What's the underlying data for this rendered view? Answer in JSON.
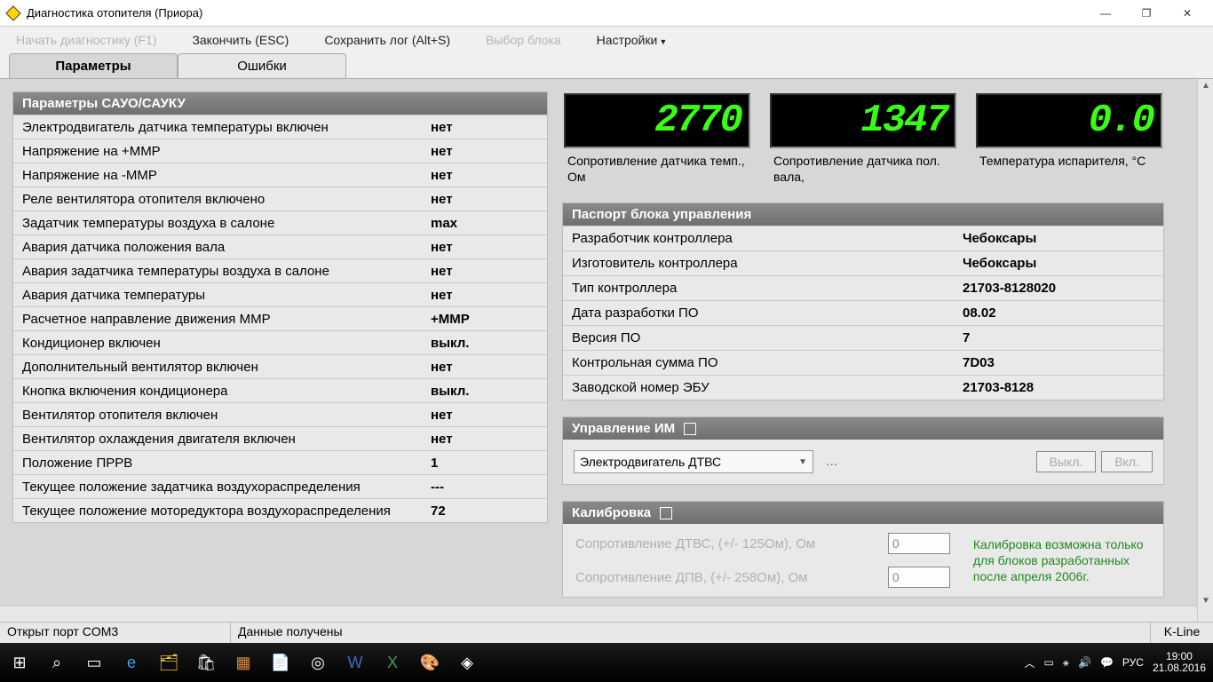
{
  "window": {
    "title": "Диагностика отопителя (Приора)"
  },
  "menu": {
    "start": "Начать диагностику (F1)",
    "stop": "Закончить (ESC)",
    "save_log": "Сохранить лог (Alt+S)",
    "block_select": "Выбор блока",
    "settings": "Настройки"
  },
  "tabs": {
    "params": "Параметры",
    "errors": "Ошибки"
  },
  "params": {
    "header": "Параметры САУО/САУКУ",
    "rows": [
      {
        "label": "Электродвигатель датчика температуры включен",
        "value": "нет"
      },
      {
        "label": "Напряжение на +ММР",
        "value": "нет"
      },
      {
        "label": "Напряжение на -ММР",
        "value": "нет"
      },
      {
        "label": "Реле вентилятора отопителя включено",
        "value": "нет"
      },
      {
        "label": "Задатчик температуры воздуха в салоне",
        "value": "max"
      },
      {
        "label": "Авария датчика положения вала",
        "value": "нет"
      },
      {
        "label": "Авария задатчика температуры воздуха в салоне",
        "value": "нет"
      },
      {
        "label": "Авария датчика температуры",
        "value": "нет"
      },
      {
        "label": "Расчетное направление движения ММР",
        "value": "+ММР"
      },
      {
        "label": "Кондиционер включен",
        "value": "выкл."
      },
      {
        "label": "Дополнительный вентилятор включен",
        "value": "нет"
      },
      {
        "label": "Кнопка включения кондиционера",
        "value": "выкл."
      },
      {
        "label": "Вентилятор отопителя включен",
        "value": "нет"
      },
      {
        "label": "Вентилятор охлаждения двигателя включен",
        "value": "нет"
      },
      {
        "label": "Положение ПРРВ",
        "value": "1"
      },
      {
        "label": "Текущее положение задатчика воздухораспределения",
        "value": "---"
      },
      {
        "label": "Текущее положение моторедуктора воздухораспределения",
        "value": "72"
      }
    ]
  },
  "gauges": [
    {
      "value": "2770",
      "caption": "Сопротивление датчика темп., Ом"
    },
    {
      "value": "1347",
      "caption": "Сопротивление датчика пол. вала,"
    },
    {
      "value": "0.0",
      "caption": "Температура испарителя, °С"
    }
  ],
  "passport": {
    "header": "Паспорт блока управления",
    "rows": [
      {
        "label": "Разработчик контроллера",
        "value": "Чебоксары"
      },
      {
        "label": "Изготовитель контроллера",
        "value": "Чебоксары"
      },
      {
        "label": "Тип контроллера",
        "value": "21703-8128020"
      },
      {
        "label": "Дата разработки ПО",
        "value": "08.02"
      },
      {
        "label": "Версия ПО",
        "value": "7"
      },
      {
        "label": "Контрольная сумма ПО",
        "value": "7D03"
      },
      {
        "label": "Заводской номер ЭБУ",
        "value": "21703-8128"
      }
    ]
  },
  "actuator": {
    "header": "Управление ИМ",
    "select": "Электродвигатель ДТВС",
    "ellipsis": "...",
    "off": "Выкл.",
    "on": "Вкл."
  },
  "calibration": {
    "header": "Калибровка",
    "rows": [
      {
        "label": "Сопротивление ДТВС, (+/- 125Ом), Ом",
        "value": "0"
      },
      {
        "label": "Сопротивление ДПВ, (+/- 258Ом), Ом",
        "value": "0"
      }
    ],
    "note": "Калибровка возможна только для блоков разработанных после апреля 2006г."
  },
  "status": {
    "port": "Открыт порт COM3",
    "data": "Данные получены",
    "kline": "K-Line"
  },
  "taskbar": {
    "lang": "РУС",
    "time": "19:00",
    "date": "21.08.2016"
  }
}
